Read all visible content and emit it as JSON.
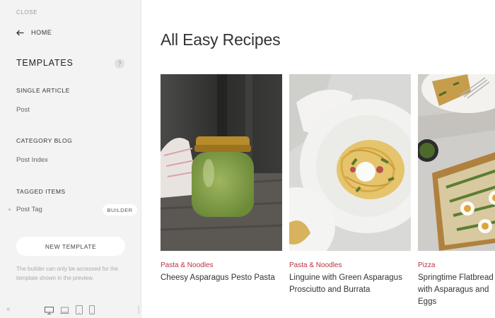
{
  "sidebar": {
    "close_label": "CLOSE",
    "home_label": "HOME",
    "templates_title": "TEMPLATES",
    "help_glyph": "?",
    "sections": [
      {
        "title": "SINGLE ARTICLE",
        "item": "Post"
      },
      {
        "title": "CATEGORY BLOG",
        "item": "Post Index"
      },
      {
        "title": "TAGGED ITEMS",
        "item": "Post Tag",
        "badge": "BUILDER"
      }
    ],
    "new_template_label": "NEW TEMPLATE",
    "note": "The builder can only be accessed for the template shown in the preview.",
    "collapse_glyph": "«"
  },
  "main": {
    "title": "All Easy Recipes",
    "cards": [
      {
        "category": "Pasta & Noodles",
        "title": "Cheesy Asparagus Pesto Pasta",
        "image": "pesto-jar-photo"
      },
      {
        "category": "Pasta & Noodles",
        "title": "Linguine with Green Asparagus Prosciutto and Burrata",
        "image": "linguine-plate-photo"
      },
      {
        "category": "Pizza",
        "title": "Springtime Flatbread with Asparagus and Eggs",
        "image": "flatbread-photo"
      }
    ]
  },
  "colors": {
    "accent_category": "#b8323f",
    "sidebar_bg": "#f3f3f3"
  }
}
